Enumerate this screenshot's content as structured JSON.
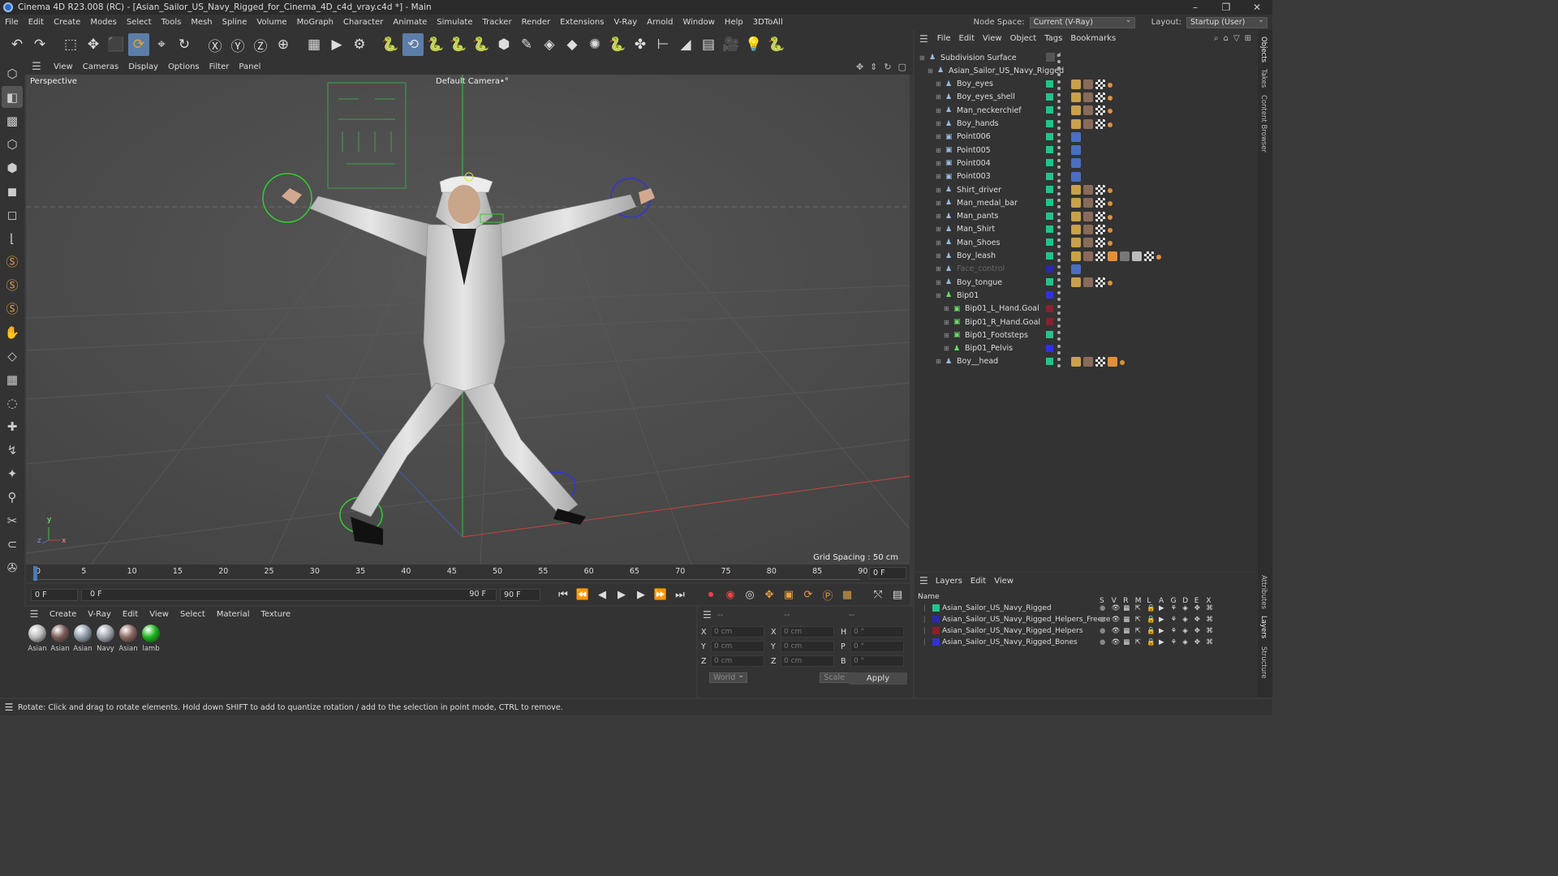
{
  "window": {
    "title": "Cinema 4D R23.008 (RC) - [Asian_Sailor_US_Navy_Rigged_for_Cinema_4D_c4d_vray.c4d *] - Main",
    "controls": [
      "–",
      "❐",
      "✕"
    ]
  },
  "menubar": {
    "items": [
      "File",
      "Edit",
      "Create",
      "Modes",
      "Select",
      "Tools",
      "Mesh",
      "Spline",
      "Volume",
      "MoGraph",
      "Character",
      "Animate",
      "Simulate",
      "Tracker",
      "Render",
      "Extensions",
      "V-Ray",
      "Arnold",
      "Window",
      "Help",
      "3DToAll"
    ],
    "node_space_label": "Node Space:",
    "node_space_value": "Current (V-Ray)",
    "layout_label": "Layout:",
    "layout_value": "Startup (User)"
  },
  "viewport": {
    "menu": [
      "View",
      "Cameras",
      "Display",
      "Options",
      "Filter",
      "Panel"
    ],
    "label": "Perspective",
    "camera": "Default Camera",
    "camera_suffix": "•°",
    "grid_spacing": "Grid Spacing : 50 cm",
    "axis_y": "y",
    "axis_z": "z",
    "axis_x": "x"
  },
  "timeline": {
    "ticks": [
      "0",
      "5",
      "10",
      "15",
      "20",
      "25",
      "30",
      "35",
      "40",
      "45",
      "50",
      "55",
      "60",
      "65",
      "70",
      "75",
      "80",
      "85",
      "90"
    ],
    "current_frame": "0 F"
  },
  "transport": {
    "start": "0 F",
    "start2": "0 F",
    "end": "90 F",
    "end2": "90 F"
  },
  "materials": {
    "menu": [
      "Create",
      "V-Ray",
      "Edit",
      "View",
      "Select",
      "Material",
      "Texture"
    ],
    "items": [
      {
        "label": "Asian",
        "color": "#b8b8b8"
      },
      {
        "label": "Asian",
        "color": "#7a5a55"
      },
      {
        "label": "Asian",
        "color": "#8e9aa8"
      },
      {
        "label": "Navy",
        "color": "#9ea4ad"
      },
      {
        "label": "Asian",
        "color": "#8a6660"
      },
      {
        "label": "lamb",
        "color": "#18b418"
      }
    ]
  },
  "coords": {
    "header_a": "--",
    "header_b": "--",
    "header_c": "--",
    "rows": [
      {
        "a": "X",
        "b": "X",
        "c": "H",
        "va": "0 cm",
        "vb": "0 cm",
        "vc": "0 °"
      },
      {
        "a": "Y",
        "b": "Y",
        "c": "P",
        "va": "0 cm",
        "vb": "0 cm",
        "vc": "0 °"
      },
      {
        "a": "Z",
        "b": "Z",
        "c": "B",
        "va": "0 cm",
        "vb": "0 cm",
        "vc": "0 °"
      }
    ],
    "mode": "World",
    "scale": "Scale",
    "apply": "Apply"
  },
  "objects": {
    "menu": [
      "File",
      "Edit",
      "View",
      "Object",
      "Tags",
      "Bookmarks"
    ],
    "rows": [
      {
        "name": "Subdivision Surface",
        "indent": 0,
        "color": "",
        "tags": 0,
        "dim": false
      },
      {
        "name": "Asian_Sailor_US_Navy_Rigged",
        "indent": 1,
        "color": "",
        "tags": 0,
        "dim": false
      },
      {
        "name": "Boy_eyes",
        "indent": 2,
        "color": "#21c48a",
        "tags": 4,
        "dim": false
      },
      {
        "name": "Boy_eyes_shell",
        "indent": 2,
        "color": "#21c48a",
        "tags": 4,
        "dim": false
      },
      {
        "name": "Man_neckerchief",
        "indent": 2,
        "color": "#21c48a",
        "tags": 4,
        "dim": false
      },
      {
        "name": "Boy_hands",
        "indent": 2,
        "color": "#21c48a",
        "tags": 4,
        "dim": false
      },
      {
        "name": "Point006",
        "indent": 2,
        "color": "#21c48a",
        "tags": 1,
        "dim": false
      },
      {
        "name": "Point005",
        "indent": 2,
        "color": "#21c48a",
        "tags": 1,
        "dim": false
      },
      {
        "name": "Point004",
        "indent": 2,
        "color": "#21c48a",
        "tags": 1,
        "dim": false
      },
      {
        "name": "Point003",
        "indent": 2,
        "color": "#21c48a",
        "tags": 1,
        "dim": false
      },
      {
        "name": "Shirt_driver",
        "indent": 2,
        "color": "#21c48a",
        "tags": 4,
        "dim": false
      },
      {
        "name": "Man_medal_bar",
        "indent": 2,
        "color": "#21c48a",
        "tags": 4,
        "dim": false
      },
      {
        "name": "Man_pants",
        "indent": 2,
        "color": "#21c48a",
        "tags": 4,
        "dim": false
      },
      {
        "name": "Man_Shirt",
        "indent": 2,
        "color": "#21c48a",
        "tags": 4,
        "dim": false
      },
      {
        "name": "Man_Shoes",
        "indent": 2,
        "color": "#21c48a",
        "tags": 4,
        "dim": false
      },
      {
        "name": "Boy_leash",
        "indent": 2,
        "color": "#21c48a",
        "tags": 8,
        "dim": false
      },
      {
        "name": "Face_control",
        "indent": 2,
        "color": "#2a2aa8",
        "tags": 1,
        "dim": true
      },
      {
        "name": "Boy_tongue",
        "indent": 2,
        "color": "#21c48a",
        "tags": 4,
        "dim": false
      },
      {
        "name": "Bip01",
        "indent": 2,
        "color": "#3030e0",
        "tags": 0,
        "dim": false
      },
      {
        "name": "Bip01_L_Hand.Goal",
        "indent": 3,
        "color": "#8a2030",
        "tags": 0,
        "dim": false
      },
      {
        "name": "Bip01_R_Hand.Goal",
        "indent": 3,
        "color": "#8a2030",
        "tags": 0,
        "dim": false
      },
      {
        "name": "Bip01_Footsteps",
        "indent": 3,
        "color": "#21c48a",
        "tags": 0,
        "dim": false
      },
      {
        "name": "Bip01_Pelvis",
        "indent": 3,
        "color": "#3030e0",
        "tags": 0,
        "dim": false
      },
      {
        "name": "Boy__head",
        "indent": 2,
        "color": "#21c48a",
        "tags": 5,
        "dim": false
      }
    ]
  },
  "layers": {
    "menu": [
      "Layers",
      "Edit",
      "View"
    ],
    "name_header": "Name",
    "cols": [
      "S",
      "V",
      "R",
      "M",
      "L",
      "A",
      "G",
      "D",
      "E",
      "X"
    ],
    "rows": [
      {
        "name": "Asian_Sailor_US_Navy_Rigged",
        "color": "#21c48a"
      },
      {
        "name": "Asian_Sailor_US_Navy_Rigged_Helpers_Freeze",
        "color": "#2a2aa8"
      },
      {
        "name": "Asian_Sailor_US_Navy_Rigged_Helpers",
        "color": "#8a2030"
      },
      {
        "name": "Asian_Sailor_US_Navy_Rigged_Bones",
        "color": "#3030e0"
      }
    ]
  },
  "right_tabs": [
    "Objects",
    "Takes",
    "Content Browser",
    "Attributes",
    "Layers",
    "Structure"
  ],
  "status": "Rotate: Click and drag to rotate elements. Hold down SHIFT to add to quantize rotation / add to the selection in point mode, CTRL to remove.",
  "toolbar": {
    "icons": [
      "undo-icon",
      "redo-icon",
      "live-select-icon",
      "move-icon",
      "scale-icon",
      "rotate-icon",
      "recent-tool-icon",
      "rotate-tool-icon",
      "x-axis-icon",
      "y-axis-icon",
      "z-axis-icon",
      "world-coord-icon",
      "render-region-icon",
      "render-view-icon",
      "render-settings-icon",
      "python-icon",
      "spin-icon",
      "python-icon-2",
      "python-icon-3",
      "python-icon-4",
      "cube-icon",
      "pen-icon",
      "subdivision-icon",
      "extrude-icon",
      "array-icon",
      "python-icon-5",
      "mograph-icon",
      "spline-icon",
      "deformer-icon",
      "floor-icon",
      "camera-icon",
      "light-icon",
      "python-icon-6"
    ]
  }
}
